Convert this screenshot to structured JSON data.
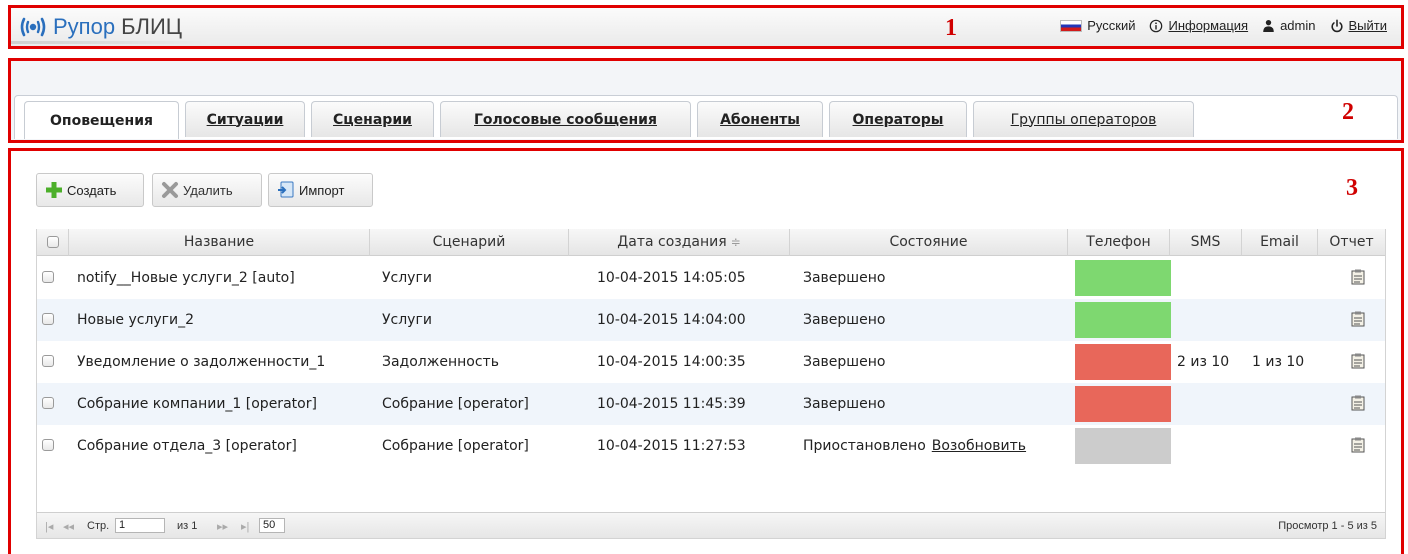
{
  "header": {
    "logo_name": "Рупор",
    "logo_suffix": "БЛИЦ",
    "marker": "1",
    "language": "Русский",
    "info_label": "Информация",
    "user": "admin",
    "logout_label": "Выйти"
  },
  "tabs_section": {
    "marker": "2",
    "tabs": [
      {
        "label": "Оповещения",
        "active": true
      },
      {
        "label": "Ситуации"
      },
      {
        "label": "Сценарии"
      },
      {
        "label": "Голосовые сообщения"
      },
      {
        "label": "Абоненты"
      },
      {
        "label": "Операторы"
      },
      {
        "label": "Группы операторов"
      }
    ]
  },
  "content": {
    "marker": "3",
    "toolbar": {
      "create_label": "Создать",
      "delete_label": "Удалить",
      "import_label": "Импорт"
    },
    "columns": [
      "Название",
      "Сценарий",
      "Дата создания",
      "Состояние",
      "Телефон",
      "SMS",
      "Email",
      "Отчет"
    ],
    "sort_indicator": "≑",
    "status_colors": {
      "green": "#7ed870",
      "red": "#e8675a",
      "gray": "#cccccc"
    },
    "rows": [
      {
        "name": "notify__Новые услуги_2 [auto]",
        "scenario": "Услуги",
        "date": "10-04-2015 14:05:05",
        "state": "Завершено",
        "action": "",
        "phone": "green",
        "sms": "",
        "email": ""
      },
      {
        "name": "Новые услуги_2",
        "scenario": "Услуги",
        "date": "10-04-2015 14:04:00",
        "state": "Завершено",
        "action": "",
        "phone": "green",
        "sms": "",
        "email": ""
      },
      {
        "name": "Уведомление о задолженности_1",
        "scenario": "Задолженность",
        "date": "10-04-2015 14:00:35",
        "state": "Завершено",
        "action": "",
        "phone": "red",
        "sms": "2 из 10",
        "email": "1 из 10"
      },
      {
        "name": "Собрание компании_1 [operator]",
        "scenario": "Собрание [operator]",
        "date": "10-04-2015 11:45:39",
        "state": "Завершено",
        "action": "",
        "phone": "red",
        "sms": "",
        "email": ""
      },
      {
        "name": "Собрание отдела_3 [operator]",
        "scenario": "Собрание [operator]",
        "date": "10-04-2015 11:27:53",
        "state": "Приостановлено",
        "action": "Возобновить",
        "phone": "gray",
        "sms": "",
        "email": ""
      }
    ],
    "pager": {
      "page_label": "Стр.",
      "page_value": "1",
      "of_label": "из 1",
      "per_page": "50",
      "summary": "Просмотр 1 - 5 из 5"
    }
  }
}
